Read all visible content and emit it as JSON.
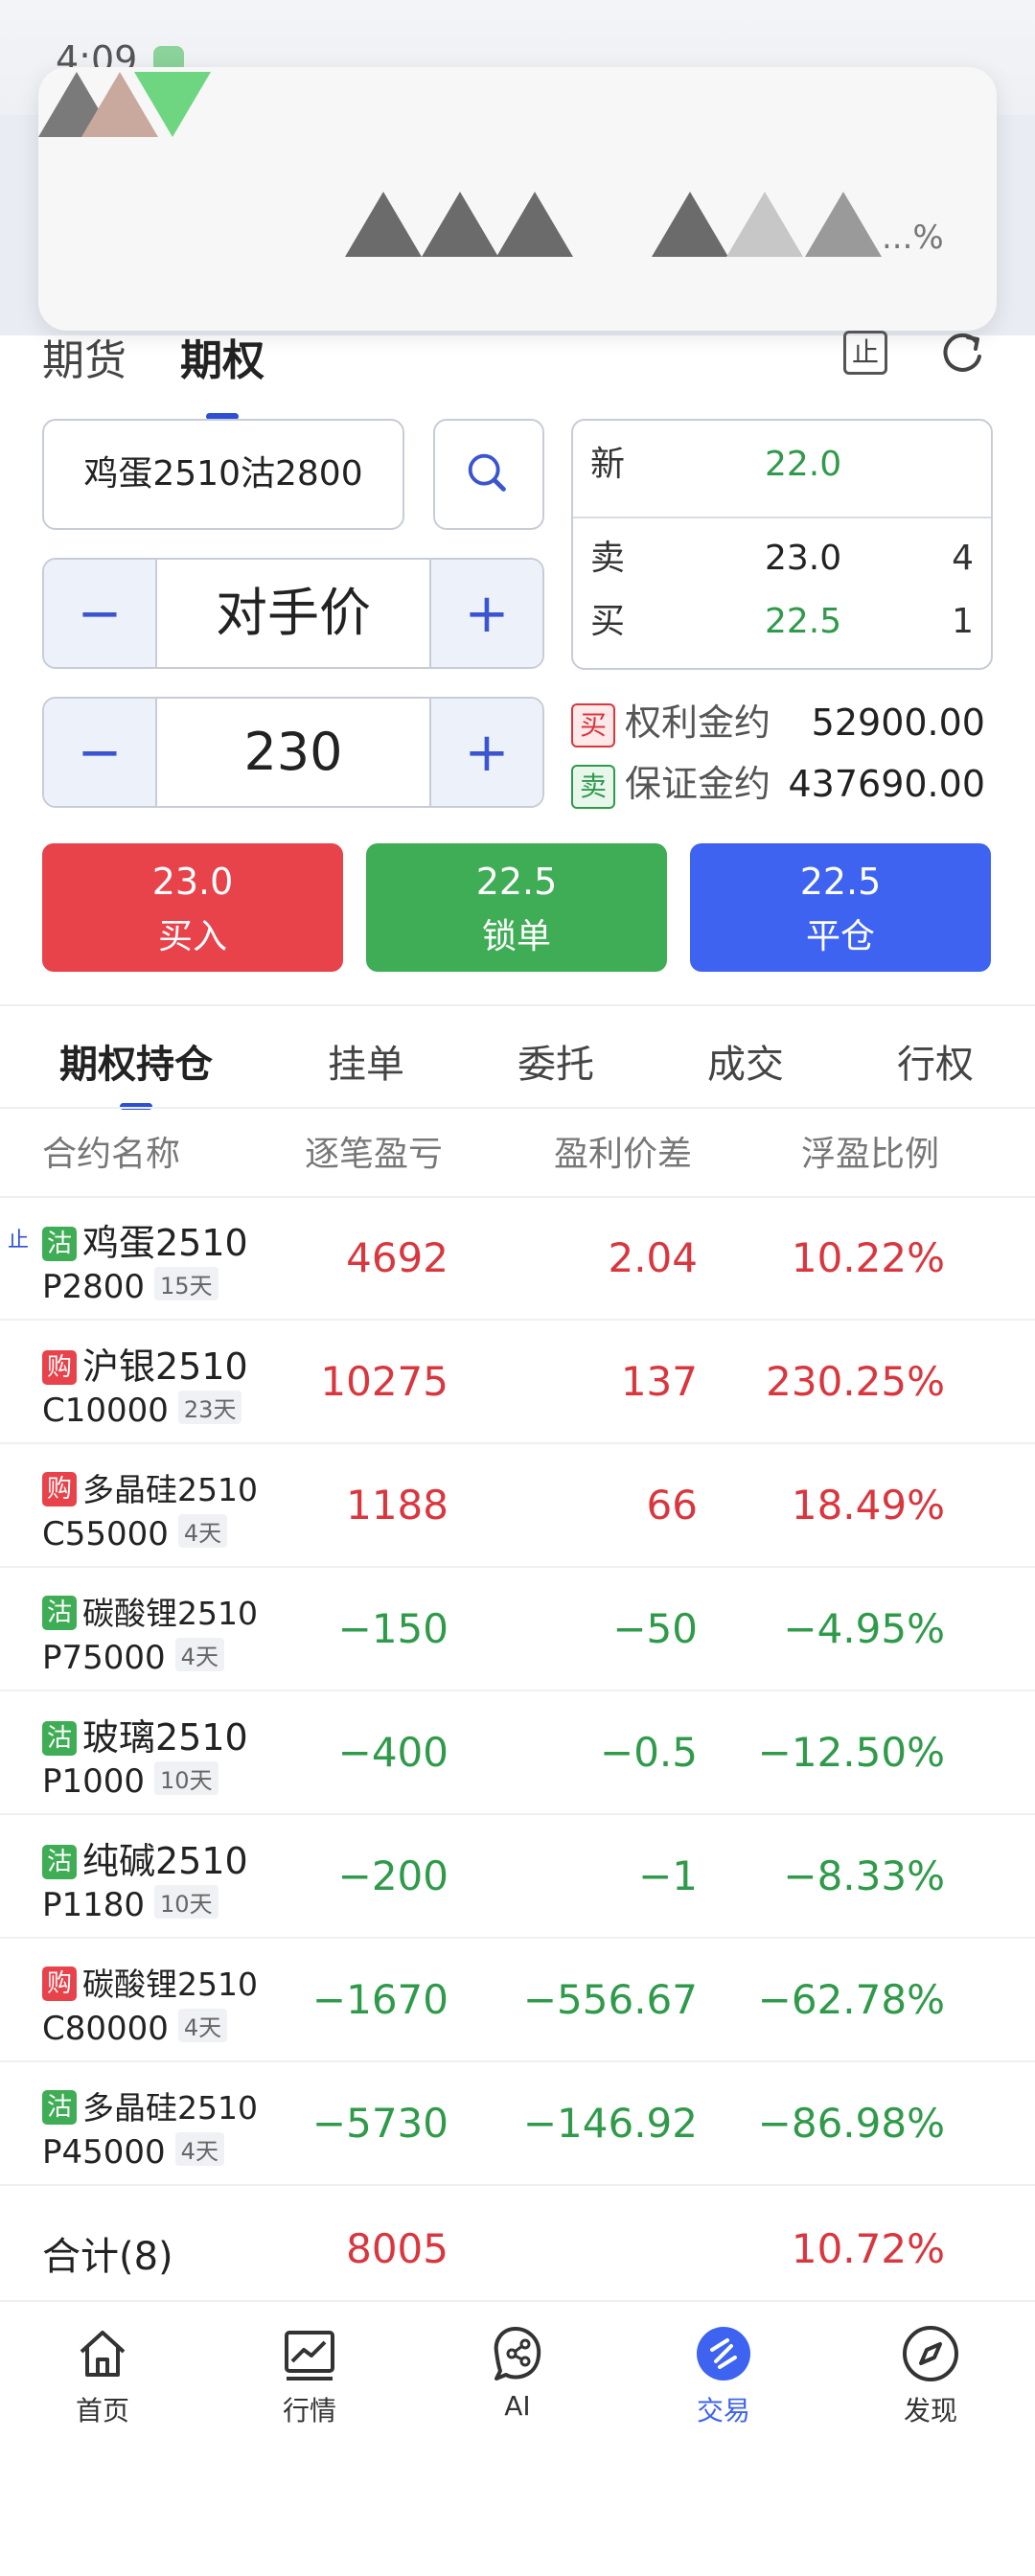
{
  "status": {
    "time": "4:09"
  },
  "header": {
    "obscured_text": "...%"
  },
  "top_tabs": [
    "期货",
    "期权"
  ],
  "order": {
    "contract": "鸡蛋2510沽2800",
    "price_mode": "对手价",
    "quantity": "230",
    "minus": "−",
    "plus": "+"
  },
  "quote": {
    "last_label": "新",
    "last_price": "22.0",
    "ask_label": "卖",
    "ask_price": "23.0",
    "ask_vol": "4",
    "bid_label": "买",
    "bid_price": "22.5",
    "bid_vol": "1"
  },
  "margins": {
    "buy_tag": "买",
    "premium_label": "权利金约",
    "premium_value": "52900.00",
    "sell_tag": "卖",
    "margin_label": "保证金约",
    "margin_value": "437690.00"
  },
  "stop_icon_text": "止",
  "actions": [
    {
      "price": "23.0",
      "label": "买入"
    },
    {
      "price": "22.5",
      "label": "锁单"
    },
    {
      "price": "22.5",
      "label": "平仓"
    }
  ],
  "position_tabs": [
    "期权持仓",
    "挂单",
    "委托",
    "成交",
    "行权"
  ],
  "columns": [
    "合约名称",
    "逐笔盈亏",
    "盈利价差",
    "浮盈比例"
  ],
  "positions": [
    {
      "badge": "沽",
      "side": "sell",
      "stop": "止",
      "name": "鸡蛋2510",
      "code": "P2800",
      "days": "15天",
      "pnl": "4692",
      "spread": "2.04",
      "ratio": "10.22%",
      "up": true,
      "small": false
    },
    {
      "badge": "购",
      "side": "buy",
      "stop": "",
      "name": "沪银2510",
      "code": "C10000",
      "days": "23天",
      "pnl": "10275",
      "spread": "137",
      "ratio": "230.25%",
      "up": true,
      "small": false
    },
    {
      "badge": "购",
      "side": "buy",
      "stop": "",
      "name": "多晶硅2510",
      "code": "C55000",
      "days": "4天",
      "pnl": "1188",
      "spread": "66",
      "ratio": "18.49%",
      "up": true,
      "small": true
    },
    {
      "badge": "沽",
      "side": "sell",
      "stop": "",
      "name": "碳酸锂2510",
      "code": "P75000",
      "days": "4天",
      "pnl": "−150",
      "spread": "−50",
      "ratio": "−4.95%",
      "up": false,
      "small": true
    },
    {
      "badge": "沽",
      "side": "sell",
      "stop": "",
      "name": "玻璃2510",
      "code": "P1000",
      "days": "10天",
      "pnl": "−400",
      "spread": "−0.5",
      "ratio": "−12.50%",
      "up": false,
      "small": false
    },
    {
      "badge": "沽",
      "side": "sell",
      "stop": "",
      "name": "纯碱2510",
      "code": "P1180",
      "days": "10天",
      "pnl": "−200",
      "spread": "−1",
      "ratio": "−8.33%",
      "up": false,
      "small": false
    },
    {
      "badge": "购",
      "side": "buy",
      "stop": "",
      "name": "碳酸锂2510",
      "code": "C80000",
      "days": "4天",
      "pnl": "−1670",
      "spread": "−556.67",
      "ratio": "−62.78%",
      "up": false,
      "small": true
    },
    {
      "badge": "沽",
      "side": "sell",
      "stop": "",
      "name": "多晶硅2510",
      "code": "P45000",
      "days": "4天",
      "pnl": "−5730",
      "spread": "−146.92",
      "ratio": "−86.98%",
      "up": false,
      "small": true
    }
  ],
  "total": {
    "label": "合计(8)",
    "pnl": "8005",
    "ratio": "10.72%"
  },
  "nav": [
    {
      "label": "首页",
      "icon": "home-icon"
    },
    {
      "label": "行情",
      "icon": "chart-icon"
    },
    {
      "label": "AI",
      "icon": "ai-icon"
    },
    {
      "label": "交易",
      "icon": "trade-icon",
      "active": true
    },
    {
      "label": "发现",
      "icon": "compass-icon"
    }
  ],
  "colors": {
    "up": "#d9363e",
    "down": "#2f9a4a",
    "accent": "#3d63f0",
    "buy": "#e8424a",
    "lock": "#3fad55"
  }
}
